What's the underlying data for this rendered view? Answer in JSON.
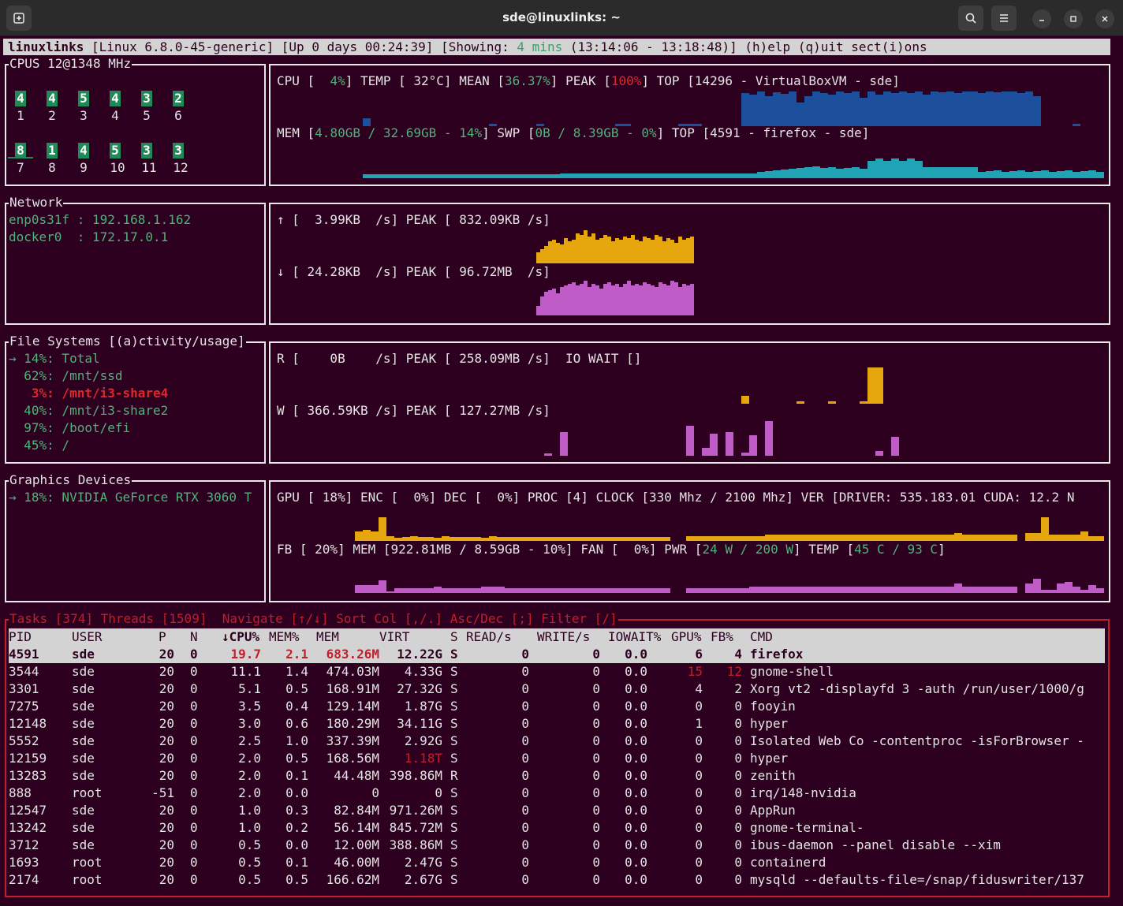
{
  "window": {
    "title": "sde@linuxlinks: ~",
    "new_tab_icon": "terminal-plus-icon",
    "search_icon": "search-icon",
    "menu_icon": "hamburger-icon",
    "minimize_icon": "minimize-icon",
    "maximize_icon": "maximize-icon",
    "close_icon": "close-icon"
  },
  "status": {
    "host": "linuxlinks",
    "kernel": " [Linux 6.8.0-45-generic] [Up 0 days 00:24:39] [Showing: ",
    "showing": "4 mins",
    "range": " (13:14:06 - 13:18:48)] (h)elp (q)uit sect(i)ons"
  },
  "cpus": {
    "title": "CPUS 12@1348 MHz",
    "cores": [
      {
        "value": "4",
        "label": "1"
      },
      {
        "value": "4",
        "label": "2"
      },
      {
        "value": "5",
        "label": "3"
      },
      {
        "value": "4",
        "label": "4"
      },
      {
        "value": "3",
        "label": "5"
      },
      {
        "value": "2",
        "label": "6"
      },
      {
        "value": "8",
        "label": "7"
      },
      {
        "value": "1",
        "label": "8"
      },
      {
        "value": "4",
        "label": "9"
      },
      {
        "value": "5",
        "label": "10"
      },
      {
        "value": "3",
        "label": "11"
      },
      {
        "value": "3",
        "label": "12"
      }
    ],
    "cpu_prefix": "CPU [  ",
    "cpu_pct": "4%",
    "cpu_mid": "] TEMP [ 32°C] MEAN [",
    "mean": "36.37%",
    "peak_prefix": "] PEAK [",
    "peak": "100%",
    "top": "] TOP [14296 - VirtualBoxVM - sde]",
    "mem_prefix": "MEM [",
    "mem": "4.80GB / 32.69GB - 14%",
    "swp_prefix": "] SWP [",
    "swp": "0B / 8.39GB - 0%",
    "mem_top": "] TOP [4591 - firefox - sde]",
    "cpu_color": "#1c4f9c",
    "mem_color": "#1fa3b5"
  },
  "network": {
    "title": "Network",
    "interfaces": [
      "enp0s31f : 192.168.1.162",
      "docker0  : 172.17.0.1"
    ],
    "up": "↑ [  3.99KB  /s] PEAK [ 832.09KB /s]",
    "down": "↓ [ 24.28KB  /s] PEAK [ 96.72MB  /s]",
    "up_color": "#e6a70e",
    "down_color": "#c05cc8"
  },
  "filesystems": {
    "title": "File Systems [(a)ctivity/usage]",
    "items": [
      {
        "text": "→ 14%: Total"
      },
      {
        "text": "  62%: /mnt/ssd"
      },
      {
        "text": "   3%: /mnt/i3-share4"
      },
      {
        "text": "  40%: /mnt/i3-share2"
      },
      {
        "text": "  97%: /boot/efi"
      },
      {
        "text": "  45%: /"
      }
    ],
    "read": "R [    0B    /s] PEAK [ 258.09MB /s]  IO WAIT []",
    "write": "W [ 366.59KB /s] PEAK [ 127.27MB /s]"
  },
  "graphics": {
    "title": "Graphics Devices",
    "device": "→ 18%: NVIDIA GeForce RTX 3060 T",
    "gpu": "GPU [ 18%] ENC [  0%] DEC [  0%] PROC [4] CLOCK [330 Mhz / 2100 Mhz] VER [DRIVER: 535.183.01 CUDA: 12.2 N",
    "fb_prefix": "FB [ 20%] MEM [922.81MB / 8.59GB - 10%] FAN [  0%] PWR [",
    "pwr": "24 W / 200 W",
    "temp_prefix": "] TEMP [",
    "temp": "45 C / 93 C",
    "temp_suffix": "]"
  },
  "tasks": {
    "title": "Tasks [374] Threads [1509]  Navigate [↑/↓] Sort Col [,/.] Asc/Dec [;] Filter [/]",
    "columns": [
      "PID",
      "USER",
      "P",
      "N",
      "↓CPU%",
      "MEM%",
      "MEM",
      "VIRT",
      "S",
      "READ/s",
      "WRITE/s",
      "IOWAIT%",
      "GPU%",
      "FB%",
      "CMD"
    ],
    "rows": [
      [
        "4591",
        "sde",
        "20",
        "0",
        "19.7",
        "2.1",
        "683.26M",
        "12.22G",
        "S",
        "0",
        "0",
        "0.0",
        "6",
        "4",
        "firefox"
      ],
      [
        "3544",
        "sde",
        "20",
        "0",
        "11.1",
        "1.4",
        "474.03M",
        "4.33G",
        "S",
        "0",
        "0",
        "0.0",
        "15",
        "12",
        "gnome-shell"
      ],
      [
        "3301",
        "sde",
        "20",
        "0",
        "5.1",
        "0.5",
        "168.91M",
        "27.32G",
        "S",
        "0",
        "0",
        "0.0",
        "4",
        "2",
        "Xorg vt2 -displayfd 3 -auth /run/user/1000/g"
      ],
      [
        "7275",
        "sde",
        "20",
        "0",
        "3.5",
        "0.4",
        "129.14M",
        "1.87G",
        "S",
        "0",
        "0",
        "0.0",
        "0",
        "0",
        "fooyin"
      ],
      [
        "12148",
        "sde",
        "20",
        "0",
        "3.0",
        "0.6",
        "180.29M",
        "34.11G",
        "S",
        "0",
        "0",
        "0.0",
        "1",
        "0",
        "hyper"
      ],
      [
        "5552",
        "sde",
        "20",
        "0",
        "2.5",
        "1.0",
        "337.39M",
        "2.92G",
        "S",
        "0",
        "0",
        "0.0",
        "0",
        "0",
        "Isolated Web Co -contentproc -isForBrowser -"
      ],
      [
        "12159",
        "sde",
        "20",
        "0",
        "2.0",
        "0.5",
        "168.56M",
        "1.18T",
        "S",
        "0",
        "0",
        "0.0",
        "0",
        "0",
        "hyper"
      ],
      [
        "13283",
        "sde",
        "20",
        "0",
        "2.0",
        "0.1",
        "44.48M",
        "398.86M",
        "R",
        "0",
        "0",
        "0.0",
        "0",
        "0",
        "zenith"
      ],
      [
        "888",
        "root",
        "-51",
        "0",
        "2.0",
        "0.0",
        "0",
        "0",
        "S",
        "0",
        "0",
        "0.0",
        "0",
        "0",
        "irq/148-nvidia"
      ],
      [
        "12547",
        "sde",
        "20",
        "0",
        "1.0",
        "0.3",
        "82.84M",
        "971.26M",
        "S",
        "0",
        "0",
        "0.0",
        "0",
        "0",
        "AppRun"
      ],
      [
        "13242",
        "sde",
        "20",
        "0",
        "1.0",
        "0.2",
        "56.14M",
        "845.72M",
        "S",
        "0",
        "0",
        "0.0",
        "0",
        "0",
        "gnome-terminal-"
      ],
      [
        "3712",
        "sde",
        "20",
        "0",
        "0.5",
        "0.0",
        "12.00M",
        "388.86M",
        "S",
        "0",
        "0",
        "0.0",
        "0",
        "0",
        "ibus-daemon --panel disable --xim"
      ],
      [
        "1693",
        "root",
        "20",
        "0",
        "0.5",
        "0.1",
        "46.00M",
        "2.47G",
        "S",
        "0",
        "0",
        "0.0",
        "0",
        "0",
        "containerd"
      ],
      [
        "2174",
        "root",
        "20",
        "0",
        "0.5",
        "0.5",
        "166.62M",
        "2.67G",
        "S",
        "0",
        "0",
        "0.0",
        "0",
        "0",
        "mysqld --defaults-file=/snap/fiduswriter/137"
      ]
    ]
  }
}
